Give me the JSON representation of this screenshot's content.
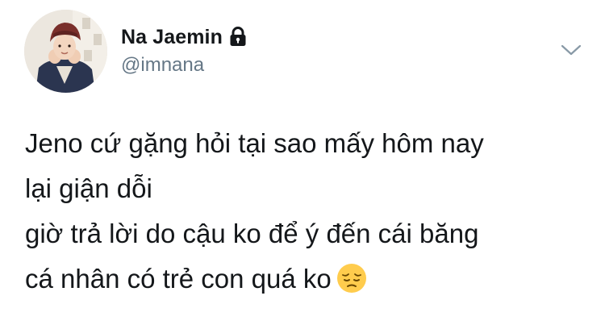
{
  "author": {
    "display_name": "Na Jaemin",
    "handle": "@imnana",
    "protected_icon": "lock-icon",
    "avatar": "profile-photo"
  },
  "menu": {
    "icon": "chevron-down-icon"
  },
  "tweet": {
    "lines": [
      "Jeno cứ gặng hỏi tại sao mấy hôm nay",
      "lại giận dỗi",
      "giờ trả lời do cậu ko để ý đến cái băng",
      "cá nhân có trẻ con quá ko"
    ],
    "emoji": "pensive-face-emoji"
  },
  "colors": {
    "text": "#14171a",
    "secondary_text": "#657786",
    "chevron": "#8899a6",
    "emoji_yellow": "#ffcc4d"
  }
}
